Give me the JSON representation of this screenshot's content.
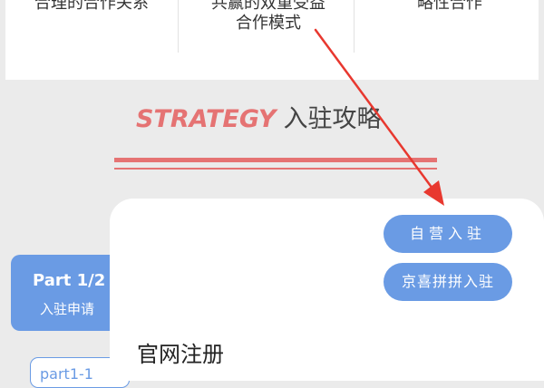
{
  "features": [
    {
      "lines": [
        "合理的合作关系"
      ]
    },
    {
      "lines": [
        "共赢的双重受益",
        "合作模式"
      ]
    },
    {
      "lines": [
        "略性合作"
      ]
    }
  ],
  "heading": {
    "en": "STRATEGY",
    "zh": "入驻攻略"
  },
  "part": {
    "title": "Part 1/2",
    "subtitle": "入驻申请",
    "chip": "part1-1"
  },
  "panel": {
    "buttons": [
      "自营入驻",
      "京喜拼拼入驻"
    ],
    "title": "官网注册"
  },
  "colors": {
    "accent_red": "#e57373",
    "primary_blue": "#6a9be4",
    "arrow_red": "#e8382f"
  }
}
